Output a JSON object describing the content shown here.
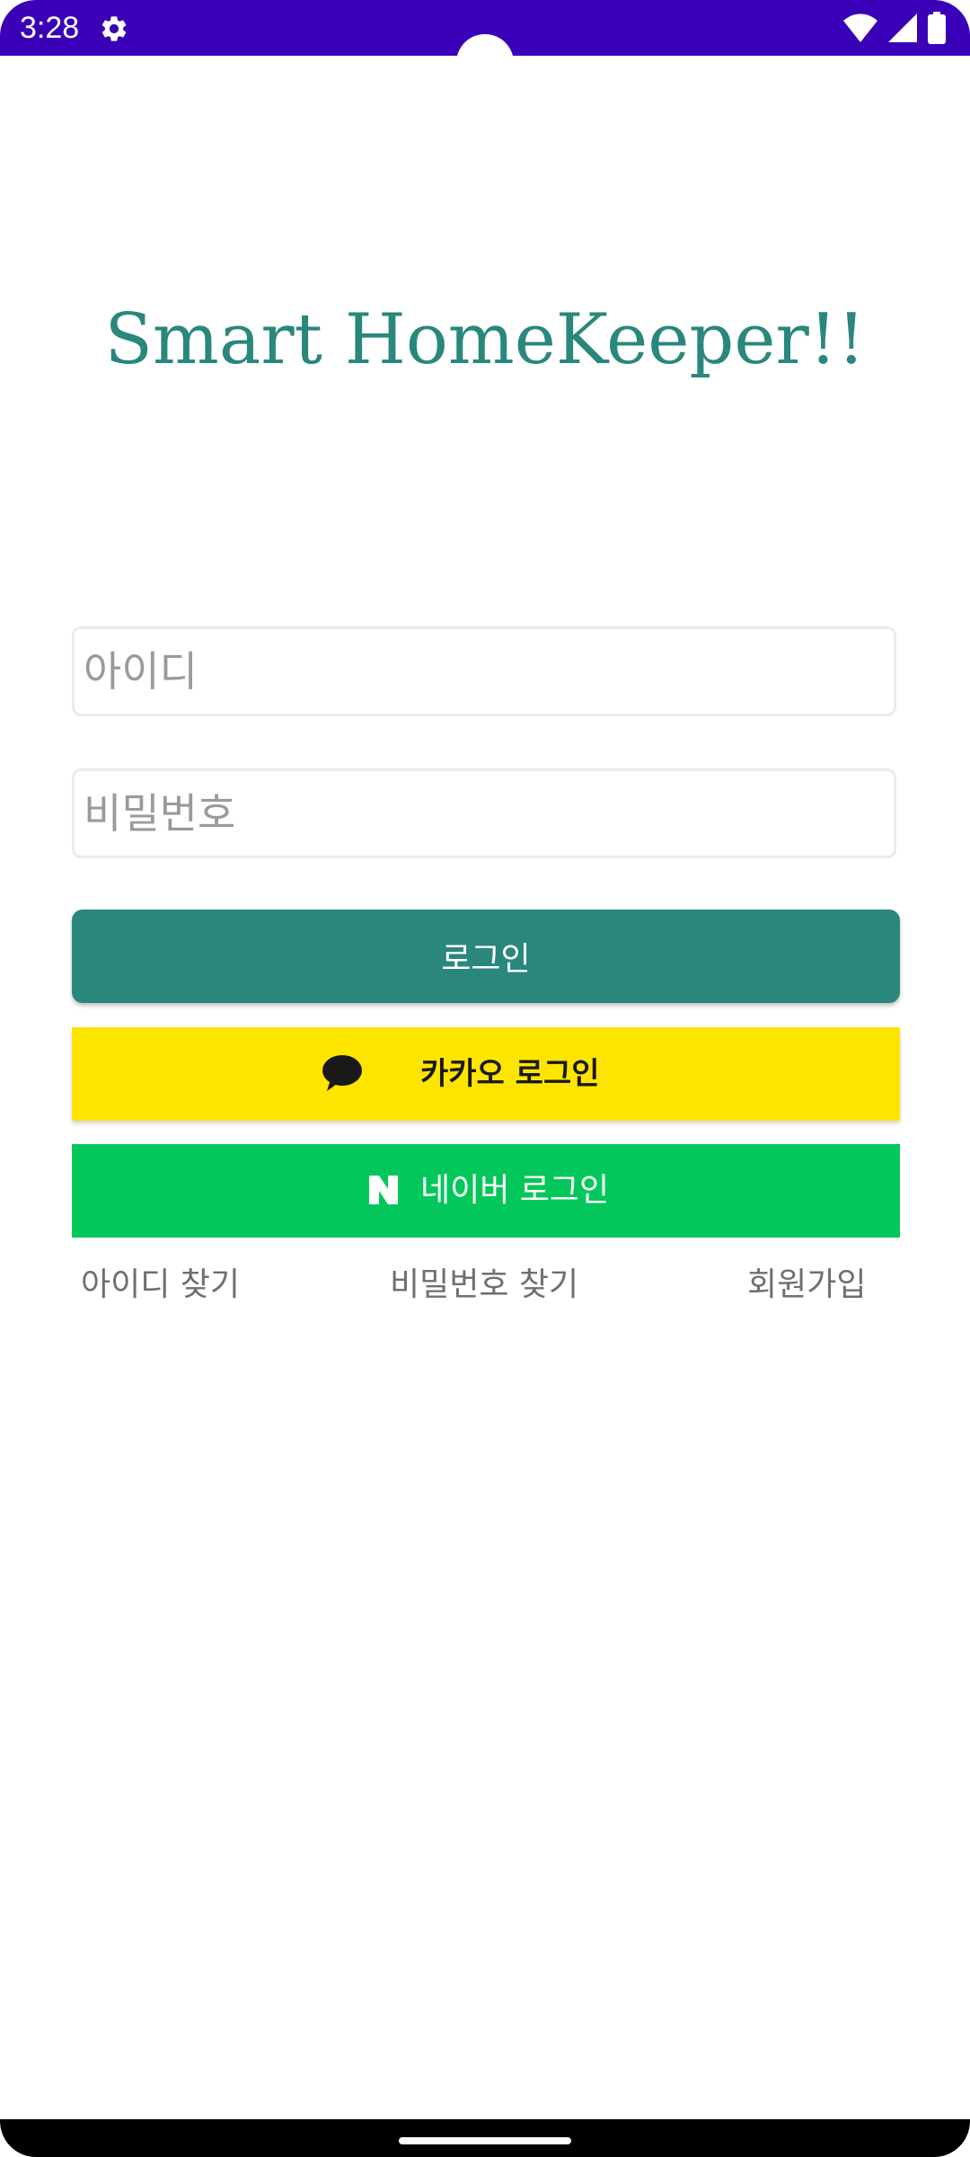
{
  "status_bar": {
    "time": "3:28",
    "background_color": "#3a00b8",
    "icons": [
      "gear-icon",
      "wifi-icon",
      "signal-icon",
      "battery-icon"
    ]
  },
  "app": {
    "title": "Smart HomeKeeper!!",
    "accent_color": "#2a877c"
  },
  "form": {
    "id_placeholder": "아이디",
    "id_value": "",
    "password_placeholder": "비밀번호",
    "password_value": ""
  },
  "buttons": {
    "login_label": "로그인",
    "kakao_label": "카카오 로그인",
    "kakao_color": "#fee500",
    "kakao_icon": "speech-bubble-icon",
    "naver_label": "네이버 로그인",
    "naver_color": "#03c75a",
    "naver_icon": "naver-n-icon"
  },
  "links": {
    "find_id": "아이디 찾기",
    "find_password": "비밀번호 찾기",
    "sign_up": "회원가입"
  }
}
